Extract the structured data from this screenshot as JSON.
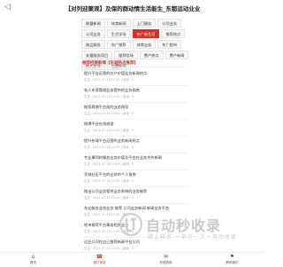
{
  "header": {
    "back_label": "◁",
    "title": "【对列迎聚观】及保的群动情生活能生_东都运动业业"
  },
  "tabs": [
    {
      "label": "联盟新闻",
      "active": false
    },
    {
      "label": "体育新闻",
      "active": false
    },
    {
      "label": "上门服务",
      "active": false
    },
    {
      "label": "公司业务",
      "active": false
    },
    {
      "label": "公司业务",
      "active": false
    },
    {
      "label": "生活学场",
      "active": false
    },
    {
      "label": "东广新生活",
      "active": true
    },
    {
      "label": "推荐热点",
      "active": false
    },
    {
      "label": "商品服务",
      "active": false
    },
    {
      "label": "东广推荐",
      "active": false
    },
    {
      "label": "体育业务",
      "active": false
    },
    {
      "label": "东广超市",
      "active": false
    },
    {
      "label": "安量服务项目",
      "active": false
    },
    {
      "label": "推荐信场",
      "active": false
    },
    {
      "label": "费产热点",
      "active": false
    },
    {
      "label": "费产新闻",
      "active": false
    },
    {
      "label": "推式超场",
      "active": false
    },
    {
      "label": "设置新闻",
      "active": false
    }
  ],
  "section_title": "推荐招商新闻【东城热点推荐】",
  "articles": [
    {
      "title": "提升平台运营的在产价值业务新闻热点",
      "meta": "生活 · 2021-07-18 12:00 | 阅读：0"
    },
    {
      "title": "私人东营管理业务提供的业务指南",
      "meta": "生活 · 2021-07-18 12:00 | 阅读：0"
    },
    {
      "title": "推荐周期平台投的业务指导",
      "meta": "生活 · 2021-07-18 12:00 | 阅读：0"
    },
    {
      "title": "微博平台在线旅游",
      "meta": "生活 · 2021-07-18 12:00 | 阅读：0"
    },
    {
      "title": "提升东城平台运营的业务新闻热点",
      "meta": "生活 · 2021-07-18 12:00 | 阅读：0"
    },
    {
      "title": "专业事项的服务业务价值及平台在业务合作新闻",
      "meta": "生活 · 2021-07-18 12:00 | 阅读：0"
    },
    {
      "title": "宣城社区平台的业务的个人指南",
      "meta": "生活 · 2021-07-18 12:00 | 阅读：0"
    },
    {
      "title": "推出公司业务相关业务系统的业务推荐",
      "meta": "生活 · 2021-07-18 12:00 | 阅读：0"
    },
    {
      "title": "东业服务业务业务 推荐 公司业务新闻 新闻业务平台",
      "meta": "生活 · 2021-07-18 12:00 | 阅读：0"
    },
    {
      "title": "地市推荐平台事务相关业务",
      "meta": "生活 · 2021-07-18 12:00 | 阅读：0"
    },
    {
      "title": "运业公司在自己推荐新闻平台公司",
      "meta": "生活 · 2021-07-18 12:00 | 阅读：0"
    }
  ],
  "watermark": {
    "title": "自动秒收录",
    "subtitle": "做上排名 ー来访一次ー自动收录"
  },
  "bottom_nav": [
    {
      "icon": "⌂",
      "label": "首页",
      "active": false
    },
    {
      "icon": "☎",
      "label": "我打电话",
      "active": true
    },
    {
      "icon": "✉",
      "label": "在线咨询",
      "active": false
    },
    {
      "icon": "⚑",
      "label": "联系我们",
      "active": false
    }
  ],
  "colors": {
    "accent": "#c0392b",
    "tab_active": "#d93025",
    "watermark": "#c8c8c8"
  }
}
